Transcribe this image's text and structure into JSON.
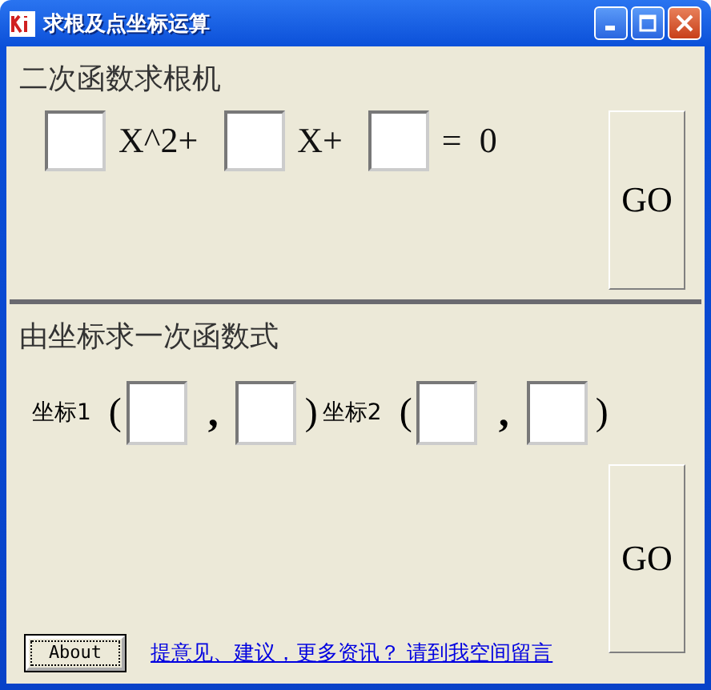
{
  "window": {
    "title": "求根及点坐标运算"
  },
  "quadratic": {
    "heading": "二次函数求根机",
    "parts": [
      {
        "kind": "field"
      },
      {
        "kind": "text",
        "text": "X^2+"
      },
      {
        "kind": "field"
      },
      {
        "kind": "text",
        "text": "X+"
      },
      {
        "kind": "field"
      },
      {
        "kind": "text",
        "text": "=  0"
      }
    ],
    "button": "GO"
  },
  "linear": {
    "heading": "由坐标求一次函数式",
    "parts": [
      {
        "kind": "label",
        "text": "坐标1"
      },
      {
        "kind": "paren",
        "text": "("
      },
      {
        "kind": "field"
      },
      {
        "kind": "comma",
        "text": ","
      },
      {
        "kind": "field"
      },
      {
        "kind": "paren",
        "text": ")"
      },
      {
        "kind": "label",
        "text": "坐标2"
      },
      {
        "kind": "paren",
        "text": "("
      },
      {
        "kind": "field"
      },
      {
        "kind": "comma",
        "text": ","
      },
      {
        "kind": "field"
      },
      {
        "kind": "paren",
        "text": ")"
      }
    ],
    "button": "GO"
  },
  "footer": {
    "about": "About",
    "link": "提意见、建议，更多资讯？ 请到我空间留言"
  }
}
